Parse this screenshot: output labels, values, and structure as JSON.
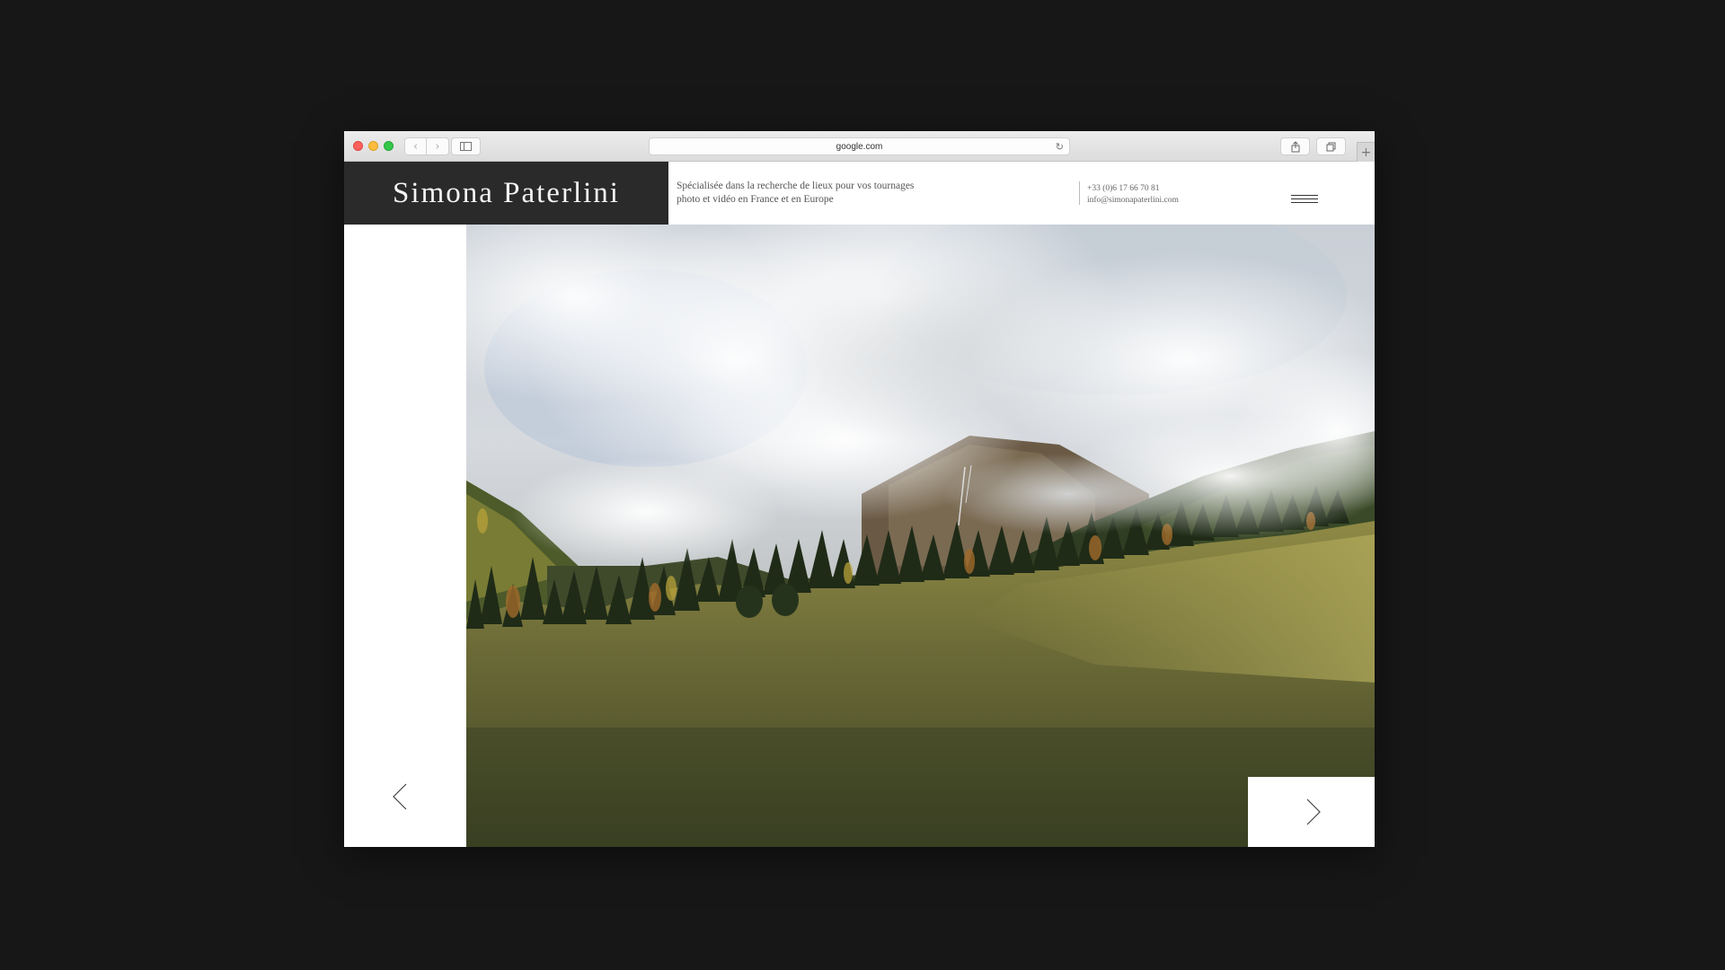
{
  "browser": {
    "url": "google.com",
    "icons": {
      "back": "chevron-left-icon",
      "forward": "chevron-right-icon",
      "sidebar": "sidebar-icon",
      "reload": "reload-icon",
      "share": "share-icon",
      "tabs": "tabs-overview-icon",
      "new_tab": "plus-icon"
    }
  },
  "site": {
    "brand": "Simona Paterlini",
    "tagline_line1": "Spécialisée dans la recherche de lieux pour vos tournages",
    "tagline_line2": "photo et vidéo en France et en Europe",
    "phone": "+33 (0)6 17 66 70 81",
    "email": "info@simonapaterlini.com",
    "brand_bg": "#2a2a2a"
  },
  "slider": {
    "image_subject": "misty mountain valley with autumn forest and meadow",
    "prev_icon": "arrow-left-icon",
    "next_icon": "arrow-right-icon"
  }
}
